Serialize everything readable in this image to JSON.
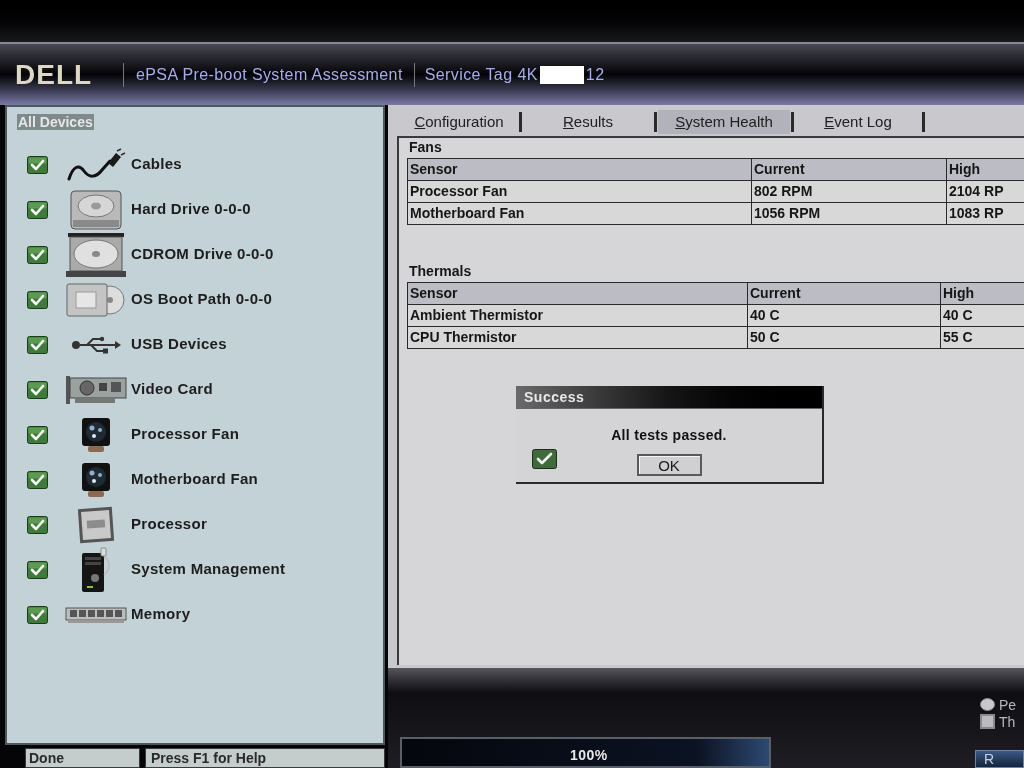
{
  "header": {
    "logo": "DELL",
    "title": "ePSA Pre-boot System Assessment",
    "service_tag": {
      "label": "Service Tag",
      "value_start": "4K",
      "value_end": "12"
    }
  },
  "sidebar": {
    "heading": {
      "label": "All Devices",
      "selected": true
    },
    "items": [
      {
        "label": "Cables",
        "checked": true
      },
      {
        "label": "Hard Drive 0-0-0",
        "checked": true
      },
      {
        "label": "CDROM Drive 0-0-0",
        "checked": true
      },
      {
        "label": "OS Boot Path 0-0-0",
        "checked": true
      },
      {
        "label": "USB Devices",
        "checked": true
      },
      {
        "label": "Video Card",
        "checked": true
      },
      {
        "label": "Processor Fan",
        "checked": true
      },
      {
        "label": "Motherboard Fan",
        "checked": true
      },
      {
        "label": "Processor",
        "checked": true
      },
      {
        "label": "System Management",
        "checked": true
      },
      {
        "label": "Memory",
        "checked": true
      }
    ]
  },
  "status_bar": {
    "status": "Done",
    "hint": "Press F1 for Help"
  },
  "tabs": [
    {
      "label": "Configuration",
      "selected": false
    },
    {
      "label": "Results",
      "selected": false
    },
    {
      "label": "System Health",
      "selected": true
    },
    {
      "label": "Event Log",
      "selected": false
    }
  ],
  "fans": {
    "title": "Fans",
    "columns": [
      "Sensor",
      "Current",
      "High"
    ],
    "rows": [
      [
        "Processor Fan",
        "802 RPM",
        "2104 RP"
      ],
      [
        "Motherboard Fan",
        "1056 RPM",
        "1083 RP"
      ]
    ]
  },
  "thermals": {
    "title": "Thermals",
    "columns": [
      "Sensor",
      "Current",
      "High"
    ],
    "rows": [
      [
        "Ambient Thermistor",
        "40 C",
        "40 C"
      ],
      [
        "CPU Thermistor",
        "50 C",
        "55 C"
      ]
    ]
  },
  "dialog": {
    "title": "Success",
    "message": "All tests passed.",
    "button": "OK"
  },
  "progress": {
    "level": 1,
    "label": "100%"
  },
  "options": [
    {
      "kind": "radio",
      "label": "Pe",
      "selected": false
    },
    {
      "kind": "checkbox",
      "label": "Th",
      "checked": false
    }
  ],
  "corner_button": {
    "label": "R"
  }
}
